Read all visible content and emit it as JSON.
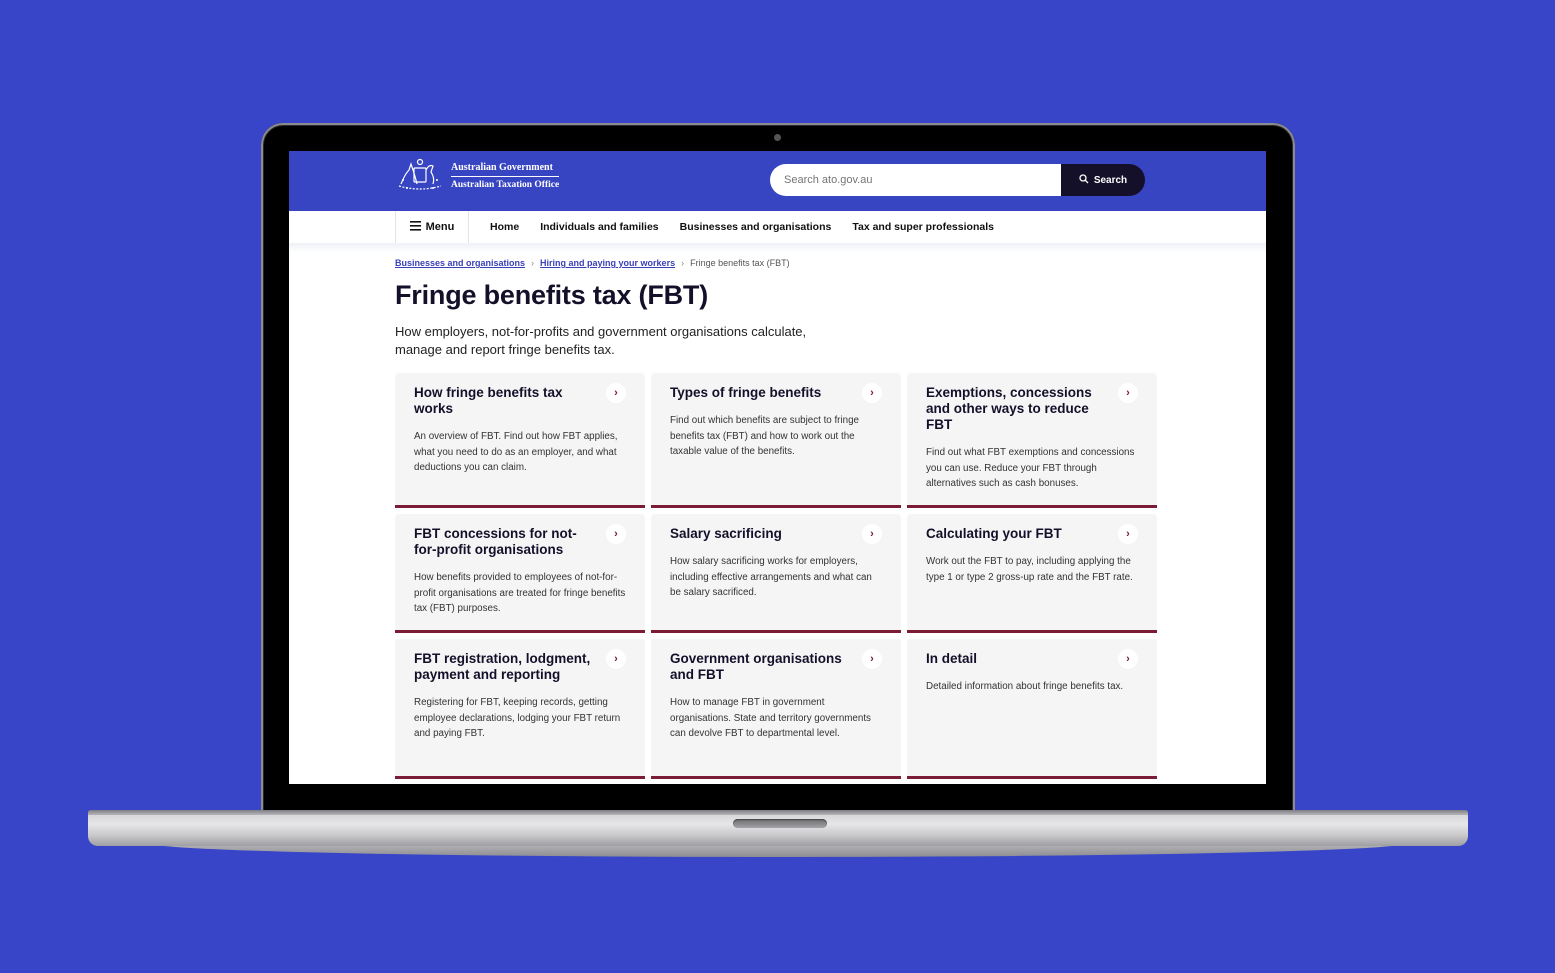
{
  "header": {
    "logo_line1": "Australian Government",
    "logo_line2": "Australian Taxation Office",
    "search_placeholder": "Search ato.gov.au",
    "search_button": "Search"
  },
  "nav": {
    "menu_label": "Menu",
    "items": [
      {
        "label": "Home"
      },
      {
        "label": "Individuals and families"
      },
      {
        "label": "Businesses and organisations"
      },
      {
        "label": "Tax and super professionals"
      }
    ]
  },
  "breadcrumb": {
    "items": [
      {
        "label": "Businesses and organisations"
      },
      {
        "label": "Hiring and paying your workers"
      }
    ],
    "current": "Fringe benefits tax (FBT)"
  },
  "page": {
    "title": "Fringe benefits tax (FBT)",
    "lead": "How employers, not-for-profits and government organisations calculate, manage and report fringe benefits tax."
  },
  "cards": [
    {
      "title": "How fringe benefits tax works",
      "desc": "An overview of FBT. Find out how FBT applies, what you need to do as an employer, and what deductions you can claim."
    },
    {
      "title": "Types of fringe benefits",
      "desc": "Find out which benefits are subject to fringe benefits tax (FBT) and how to work out the taxable value of the benefits."
    },
    {
      "title": "Exemptions, concessions and other ways to reduce FBT",
      "desc": "Find out what FBT exemptions and concessions you can use. Reduce your FBT through alternatives such as cash bonuses."
    },
    {
      "title": "FBT concessions for not-for-profit organisations",
      "desc": "How benefits provided to employees of not-for-profit organisations are treated for fringe benefits tax (FBT) purposes."
    },
    {
      "title": "Salary sacrificing",
      "desc": "How salary sacrificing works for employers, including effective arrangements and what can be salary sacrificed."
    },
    {
      "title": "Calculating your FBT",
      "desc": "Work out the FBT to pay, including applying the type 1 or type 2 gross-up rate and the FBT rate."
    },
    {
      "title": "FBT registration, lodgment, payment and reporting",
      "desc": "Registering for FBT, keeping records, getting employee declarations, lodging your FBT return and paying FBT."
    },
    {
      "title": "Government organisations and FBT",
      "desc": "How to manage FBT in government organisations. State and territory governments can devolve FBT to departmental level."
    },
    {
      "title": "In detail",
      "desc": "Detailed information about fringe benefits tax."
    }
  ],
  "icons": {
    "crest": "coat-of-arms",
    "menu": "hamburger",
    "search": "magnifier",
    "card_link": "chevron-right"
  },
  "colors": {
    "background": "#3845c8",
    "header": "#3745c2",
    "search_button": "#14102a",
    "card_accent": "#7a1c35",
    "card_bg": "#f5f5f5"
  }
}
